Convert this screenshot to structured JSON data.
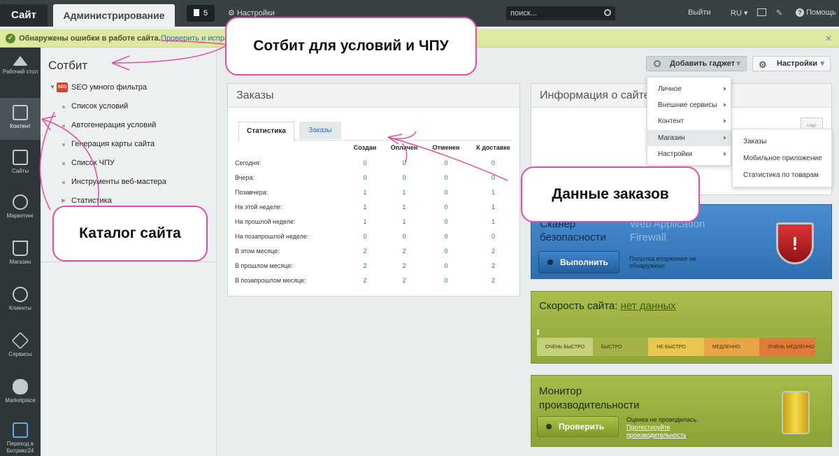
{
  "topbar": {
    "site_tab": "Сайт",
    "admin_tab": "Администрирование",
    "notif_count": "5",
    "settings": "Настройки",
    "search_placeholder": "поиск...",
    "logout": "Выйти",
    "lang": "RU",
    "help": "Помощь"
  },
  "alert": {
    "text": "Обнаружены ошибки в работе сайта.",
    "link": "Проверить и испра"
  },
  "sidebar": {
    "items": [
      {
        "label": "Рабочий стол",
        "icon": "home-icon"
      },
      {
        "label": "Контент",
        "icon": "document-icon"
      },
      {
        "label": "Сайты",
        "icon": "calendar-icon"
      },
      {
        "label": "Маркетинг",
        "icon": "target-icon"
      },
      {
        "label": "Магазин",
        "icon": "basket-icon"
      },
      {
        "label": "Клиенты",
        "icon": "clients-icon"
      },
      {
        "label": "Сервисы",
        "icon": "layers-icon"
      },
      {
        "label": "Marketplace",
        "icon": "cloud-download-icon"
      },
      {
        "label": "Переход в Битрикс24",
        "icon": "bitrix24-icon"
      }
    ]
  },
  "catalog": {
    "title": "Сотбит",
    "root": "SEO умного фильтра",
    "root_badge": "SEO",
    "items": [
      "Список условий",
      "Автогенерация условий",
      "Генерация карты сайта",
      "Список ЧПУ",
      "Инструменты веб-мастера",
      "Статистика"
    ]
  },
  "gadgets": {
    "add_label": "Добавить гаджет",
    "settings_label": "Настройки"
  },
  "orders": {
    "title": "Заказы",
    "tabs": [
      "Статистика",
      "Заказы"
    ],
    "columns": [
      "Создан",
      "Оплачен",
      "Отменен",
      "К доставке"
    ],
    "rows": [
      {
        "label": "Сегодня:",
        "values": [
          "0",
          "0",
          "0",
          "0"
        ]
      },
      {
        "label": "Вчера:",
        "values": [
          "0",
          "0",
          "0",
          "0"
        ]
      },
      {
        "label": "Позавчера:",
        "values": [
          "1",
          "1",
          "0",
          "1"
        ]
      },
      {
        "label": "На этой неделе:",
        "values": [
          "1",
          "1",
          "0",
          "1"
        ]
      },
      {
        "label": "На прошлой неделе:",
        "values": [
          "1",
          "1",
          "0",
          "1"
        ]
      },
      {
        "label": "На позапрошлой неделе:",
        "values": [
          "0",
          "0",
          "0",
          "0"
        ]
      },
      {
        "label": "В этом месяце:",
        "values": [
          "2",
          "2",
          "0",
          "2"
        ]
      },
      {
        "label": "В прошлом месяце:",
        "values": [
          "2",
          "2",
          "0",
          "2"
        ]
      },
      {
        "label": "В позапрошлом месяце:",
        "values": [
          "2",
          "2",
          "0",
          "2"
        ]
      }
    ]
  },
  "info": {
    "title": "Информация о сайте",
    "logo": "Logo"
  },
  "menu": {
    "items": [
      "Личное",
      "Внешние сервисы",
      "Контент",
      "Магазин",
      "Настройки"
    ],
    "submenu": [
      "Заказы",
      "Мобильное приложение",
      "Статистика по товарам"
    ]
  },
  "scanner": {
    "title_line1": "Сканер",
    "title_line2": "безопасности",
    "wa_line1": "Web Application",
    "wa_line2": "Firewall",
    "button": "Выполнить",
    "status": "Попытка вторжения не обнаружено"
  },
  "speed": {
    "title": "Скорость сайта:",
    "value": "нет данных",
    "scale": [
      "ОЧЕНЬ БЫСТРО",
      "БЫСТРО",
      "НЕ БЫСТРО",
      "МЕДЛЕННО",
      "ОЧЕНЬ МЕДЛЕННО"
    ],
    "colors": [
      "#c4d07a",
      "#a4b24a",
      "#e8c650",
      "#e7a546",
      "#e07a3a"
    ]
  },
  "monitor": {
    "title_line1": "Монитор",
    "title_line2": "производительности",
    "button": "Проверить",
    "status": "Оценка не проводилась.",
    "link": "Протестируйте производительность",
    "link_suffix": "."
  },
  "callouts": {
    "sotbit": "Сотбит для условий и ЧПУ",
    "orders": "Данные заказов",
    "catalog": "Каталог сайта"
  }
}
